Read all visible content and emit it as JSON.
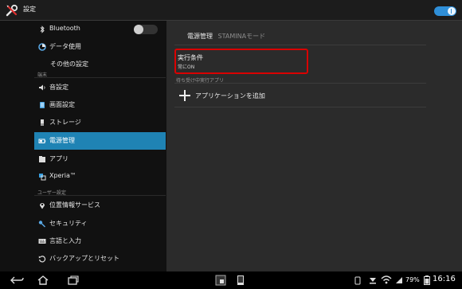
{
  "titlebar": {
    "title": "設定",
    "icon": "wrench-screwdriver-icon",
    "master_switch": "on"
  },
  "sidebar": {
    "bluetooth": {
      "label": "Bluetooth",
      "switch": "off"
    },
    "data_usage": "データ使用",
    "other_settings": "その他の設定",
    "section_device": "端末",
    "sound": "音設定",
    "display": "画面設定",
    "storage": "ストレージ",
    "power": "電源管理",
    "apps": "アプリ",
    "xperia": "Xperia™",
    "section_user": "ユーザー設定",
    "location": "位置情報サービス",
    "security": "セキュリティ",
    "language": "言語と入力",
    "backup": "バックアップとリセット"
  },
  "content": {
    "breadcrumb_parent": "電源管理",
    "breadcrumb_current": "STAMINAモード",
    "condition_title": "実行条件",
    "condition_value": "常にON",
    "standby_header": "待ち受け中実行アプリ",
    "add_app_label": "アプリケーションを追加"
  },
  "statusbar": {
    "battery": "79%",
    "time": "16:16"
  },
  "colors": {
    "accent": "#1f83b4",
    "highlight_border": "#d90000",
    "toggle_on": "#2f8fd8"
  }
}
